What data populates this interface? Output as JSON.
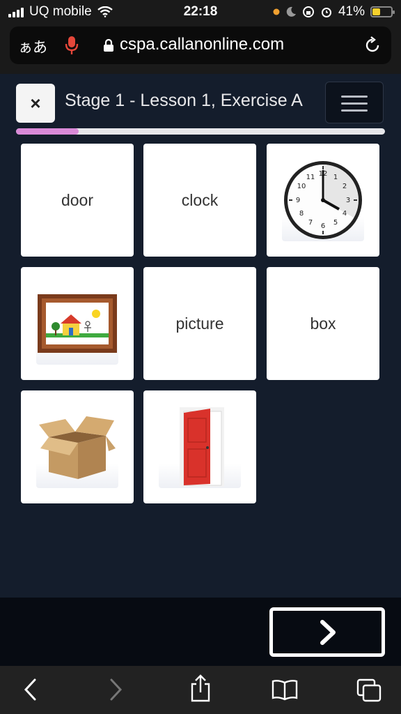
{
  "status_bar": {
    "carrier": "UQ mobile",
    "time": "22:18",
    "battery": "41%",
    "battery_level": 0.41
  },
  "browser": {
    "text_size_label": "ぁあ",
    "url": "cspa.callanonline.com"
  },
  "lesson": {
    "title": "Stage 1 - Lesson 1, Exercise A",
    "close_label": "×",
    "progress": 0.17
  },
  "cards": [
    {
      "type": "text",
      "text": "door"
    },
    {
      "type": "text",
      "text": "clock"
    },
    {
      "type": "image",
      "icon": "clock-image"
    },
    {
      "type": "image",
      "icon": "picture-frame-image"
    },
    {
      "type": "text",
      "text": "picture"
    },
    {
      "type": "text",
      "text": "box"
    },
    {
      "type": "image",
      "icon": "cardboard-box-image"
    },
    {
      "type": "image",
      "icon": "red-door-image"
    }
  ],
  "colors": {
    "background": "#141d2c",
    "progress": "#d98ad8",
    "card": "#ffffff",
    "door_red": "#d9322b"
  }
}
